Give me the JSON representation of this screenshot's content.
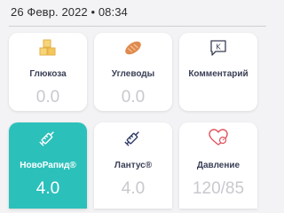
{
  "header": {
    "datetime": "26 Февр. 2022 • 08:34"
  },
  "tiles": [
    {
      "label": "Глюкоза",
      "value": "0.0",
      "icon": "sugar-cubes-icon",
      "icon_color": "#f5c75b",
      "active": false
    },
    {
      "label": "Углеводы",
      "value": "0.0",
      "icon": "bread-icon",
      "icon_color": "#e08a4f",
      "active": false
    },
    {
      "label": "Комментарий",
      "value": "",
      "icon": "comment-icon",
      "icon_color": "#3a3f55",
      "active": false
    },
    {
      "label": "НовоРапид®",
      "value": "4.0",
      "icon": "syringe-icon",
      "icon_color": "#ffffff",
      "active": true
    },
    {
      "label": "Лантус®",
      "value": "4.0",
      "icon": "syringe-icon",
      "icon_color": "#2f3b66",
      "active": false
    },
    {
      "label": "Давление",
      "value": "120/85",
      "icon": "heart-pressure-icon",
      "icon_color": "#e0505a",
      "active": false
    }
  ],
  "colors": {
    "active_tile": "#2cc0bb",
    "inactive_value": "#c8c9ce",
    "label": "#3a3f55",
    "background": "#f3f3f5"
  }
}
